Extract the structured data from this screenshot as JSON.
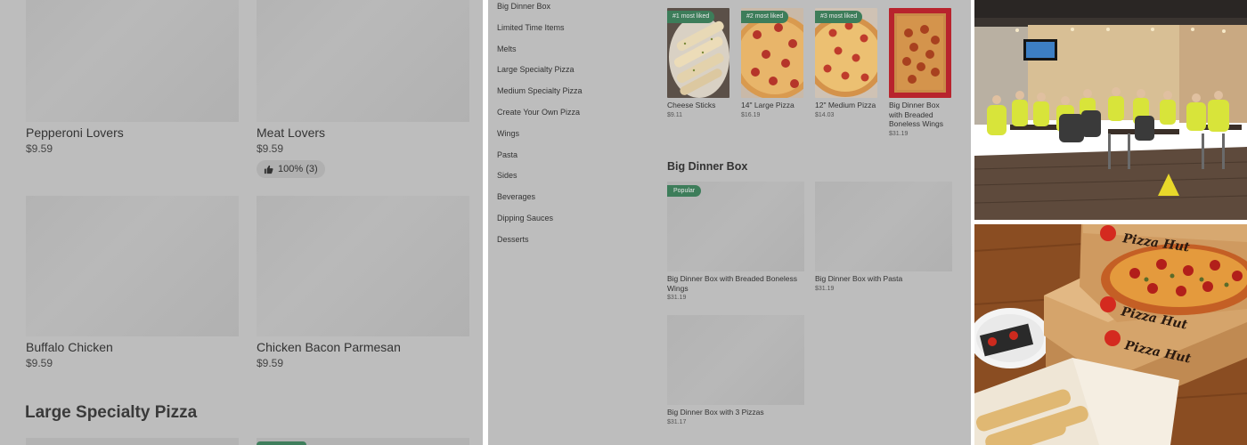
{
  "panel1": {
    "cards": [
      {
        "name": "Pepperoni Lovers",
        "price": "$9.59"
      },
      {
        "name": "Meat Lovers",
        "price": "$9.59",
        "rating": "100% (3)"
      },
      {
        "name": "Buffalo Chicken",
        "price": "$9.59"
      },
      {
        "name": "Chicken Bacon Parmesan",
        "price": "$9.59"
      }
    ],
    "section_heading": "Large Specialty Pizza"
  },
  "panel2": {
    "nav": [
      "Big Dinner Box",
      "Limited Time Items",
      "Melts",
      "Large Specialty Pizza",
      "Medium Specialty Pizza",
      "Create Your Own Pizza",
      "Wings",
      "Pasta",
      "Sides",
      "Beverages",
      "Dipping Sauces",
      "Desserts"
    ],
    "most_liked": [
      {
        "badge": "#1 most liked",
        "name": "Cheese Sticks",
        "price": "$9.11"
      },
      {
        "badge": "#2 most liked",
        "name": "14\" Large Pizza",
        "price": "$16.19"
      },
      {
        "badge": "#3 most liked",
        "name": "12\" Medium Pizza",
        "price": "$14.03"
      },
      {
        "badge": "",
        "name": "Big Dinner Box with Breaded Boneless Wings",
        "price": "$31.19"
      }
    ],
    "section_heading": "Big Dinner Box",
    "dinner_items": [
      {
        "badge": "Popular",
        "name": "Big Dinner Box with Breaded Boneless Wings",
        "price": "$31.19"
      },
      {
        "badge": "",
        "name": "Big Dinner Box with Pasta",
        "price": "$31.19"
      },
      {
        "badge": "",
        "name": "Big Dinner Box with 3 Pizzas",
        "price": "$31.17"
      }
    ]
  },
  "panel4": {
    "box_brand": "Pizza Hut"
  },
  "colors": {
    "overlay_gray": "#bdbdbd",
    "badge_green": "#3d7d5a"
  }
}
